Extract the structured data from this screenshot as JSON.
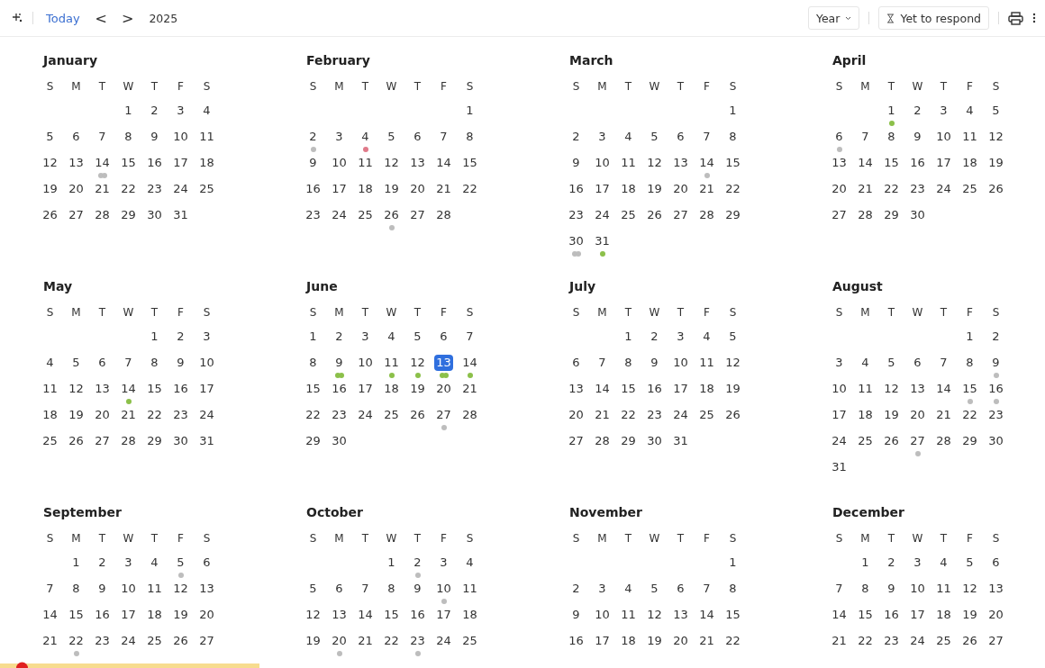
{
  "toolbar": {
    "today": "Today",
    "prev": "<",
    "next": ">",
    "year": "2025",
    "view": "Year",
    "filter": "Yet to respond"
  },
  "months": [
    {
      "name": "January",
      "weekdays": [
        "S",
        "M",
        "T",
        "W",
        "T",
        "F",
        "S"
      ],
      "weeks": [
        [
          "1",
          "2",
          "3",
          "4"
        ],
        [
          "5",
          "6",
          "7",
          "8",
          "9",
          "10",
          "11"
        ],
        [
          "12",
          "13",
          {
            "day": "14",
            "dots": [
              {
                "color": "#bdbdbd"
              },
              {
                "color": "#bdbdbd"
              }
            ]
          },
          "15",
          "16",
          "17",
          "18"
        ],
        [
          "19",
          "20",
          "21",
          "22",
          "23",
          "24",
          "25"
        ],
        [
          "26",
          "27",
          "28",
          "29",
          "30",
          "31"
        ]
      ]
    },
    {
      "name": "February",
      "weekdays": [
        "S",
        "M",
        "T",
        "W",
        "T",
        "F",
        "S"
      ],
      "weeks": [
        [
          "1"
        ],
        [
          {
            "day": "2",
            "dots": [
              {
                "color": "#bdbdbd"
              }
            ]
          },
          "3",
          {
            "day": "4",
            "dots": [
              {
                "color": "#e07a8a"
              }
            ]
          },
          "5",
          "6",
          "7",
          "8"
        ],
        [
          "9",
          "10",
          "11",
          "12",
          "13",
          "14",
          "15"
        ],
        [
          "16",
          "17",
          "18",
          "19",
          "20",
          "21",
          "22"
        ],
        [
          "23",
          "24",
          "25",
          {
            "day": "26",
            "dots": [
              {
                "color": "#bdbdbd"
              }
            ]
          },
          "27",
          "28"
        ]
      ]
    },
    {
      "name": "March",
      "weekdays": [
        "S",
        "M",
        "T",
        "W",
        "T",
        "F",
        "S"
      ],
      "weeks": [
        [
          "1"
        ],
        [
          "2",
          "3",
          "4",
          "5",
          "6",
          "7",
          "8"
        ],
        [
          "9",
          "10",
          "11",
          "12",
          "13",
          {
            "day": "14",
            "dots": [
              {
                "color": "#bdbdbd"
              }
            ]
          },
          "15"
        ],
        [
          "16",
          "17",
          "18",
          "19",
          "20",
          "21",
          "22"
        ],
        [
          "23",
          "24",
          "25",
          "26",
          "27",
          "28",
          "29"
        ],
        [
          {
            "day": "30",
            "dots": [
              {
                "color": "#bdbdbd"
              },
              {
                "color": "#bdbdbd"
              }
            ]
          },
          {
            "day": "31",
            "dots": [
              {
                "color": "#8cc04a"
              }
            ]
          }
        ]
      ]
    },
    {
      "name": "April",
      "weekdays": [
        "S",
        "M",
        "T",
        "W",
        "T",
        "F",
        "S"
      ],
      "weeks": [
        [
          {
            "day": "1",
            "dots": [
              {
                "color": "#8cc04a"
              }
            ]
          },
          "2",
          "3",
          "4",
          "5"
        ],
        [
          {
            "day": "6",
            "dots": [
              {
                "color": "#bdbdbd"
              }
            ]
          },
          "7",
          "8",
          "9",
          "10",
          "11",
          "12"
        ],
        [
          "13",
          "14",
          "15",
          "16",
          "17",
          "18",
          "19"
        ],
        [
          "20",
          "21",
          "22",
          "23",
          "24",
          "25",
          "26"
        ],
        [
          "27",
          "28",
          "29",
          "30"
        ]
      ]
    },
    {
      "name": "May",
      "weekdays": [
        "S",
        "M",
        "T",
        "W",
        "T",
        "F",
        "S"
      ],
      "weeks": [
        [
          "1",
          "2",
          "3"
        ],
        [
          "4",
          "5",
          "6",
          "7",
          "8",
          "9",
          "10"
        ],
        [
          "11",
          "12",
          "13",
          {
            "day": "14",
            "dots": [
              {
                "color": "#8cc04a"
              }
            ]
          },
          "15",
          "16",
          "17"
        ],
        [
          "18",
          "19",
          "20",
          "21",
          "22",
          "23",
          "24"
        ],
        [
          "25",
          "26",
          "27",
          "28",
          "29",
          "30",
          "31"
        ]
      ]
    },
    {
      "name": "June",
      "weekdays": [
        "S",
        "M",
        "T",
        "W",
        "T",
        "F",
        "S"
      ],
      "weeks": [
        [
          "1",
          "2",
          "3",
          "4",
          "5",
          "6",
          "7"
        ],
        [
          "8",
          {
            "day": "9",
            "dots": [
              {
                "color": "#8cc04a"
              },
              {
                "color": "#8cc04a"
              }
            ]
          },
          "10",
          {
            "day": "11",
            "dots": [
              {
                "color": "#8cc04a"
              }
            ]
          },
          {
            "day": "12",
            "dots": [
              {
                "color": "#8cc04a"
              }
            ]
          },
          {
            "day": "13",
            "selected": true,
            "dots": [
              {
                "color": "#8cc04a"
              },
              {
                "color": "#8cc04a"
              }
            ]
          },
          {
            "day": "14",
            "dots": [
              {
                "color": "#8cc04a"
              }
            ]
          }
        ],
        [
          "15",
          "16",
          "17",
          "18",
          "19",
          "20",
          "21"
        ],
        [
          "22",
          "23",
          "24",
          "25",
          "26",
          {
            "day": "27",
            "dots": [
              {
                "color": "#bdbdbd"
              }
            ]
          },
          "28"
        ],
        [
          "29",
          "30"
        ]
      ]
    },
    {
      "name": "July",
      "weekdays": [
        "S",
        "M",
        "T",
        "W",
        "T",
        "F",
        "S"
      ],
      "weeks": [
        [
          "1",
          "2",
          "3",
          "4",
          "5"
        ],
        [
          "6",
          "7",
          "8",
          "9",
          "10",
          "11",
          "12"
        ],
        [
          "13",
          "14",
          "15",
          "16",
          "17",
          "18",
          "19"
        ],
        [
          "20",
          "21",
          "22",
          "23",
          "24",
          "25",
          "26"
        ],
        [
          "27",
          "28",
          "29",
          "30",
          "31"
        ]
      ]
    },
    {
      "name": "August",
      "weekdays": [
        "S",
        "M",
        "T",
        "W",
        "T",
        "F",
        "S"
      ],
      "weeks": [
        [
          "1",
          "2"
        ],
        [
          "3",
          "4",
          "5",
          "6",
          "7",
          "8",
          {
            "day": "9",
            "dots": [
              {
                "color": "#bdbdbd"
              }
            ]
          }
        ],
        [
          "10",
          "11",
          "12",
          "13",
          "14",
          {
            "day": "15",
            "dots": [
              {
                "color": "#bdbdbd"
              }
            ]
          },
          {
            "day": "16",
            "dots": [
              {
                "color": "#bdbdbd"
              }
            ]
          }
        ],
        [
          "17",
          "18",
          "19",
          "20",
          "21",
          "22",
          "23"
        ],
        [
          "24",
          "25",
          "26",
          {
            "day": "27",
            "dots": [
              {
                "color": "#bdbdbd"
              }
            ]
          },
          "28",
          "29",
          "30"
        ],
        [
          "31"
        ]
      ]
    },
    {
      "name": "September",
      "weekdays": [
        "S",
        "M",
        "T",
        "W",
        "T",
        "F",
        "S"
      ],
      "weeks": [
        [
          "1",
          "2",
          "3",
          "4",
          {
            "day": "5",
            "dots": [
              {
                "color": "#bdbdbd"
              }
            ]
          },
          "6"
        ],
        [
          "7",
          "8",
          "9",
          "10",
          "11",
          "12",
          "13"
        ],
        [
          "14",
          "15",
          "16",
          "17",
          "18",
          "19",
          "20"
        ],
        [
          "21",
          {
            "day": "22",
            "dots": [
              {
                "color": "#bdbdbd"
              }
            ]
          },
          "23",
          "24",
          "25",
          "26",
          "27"
        ]
      ]
    },
    {
      "name": "October",
      "weekdays": [
        "S",
        "M",
        "T",
        "W",
        "T",
        "F",
        "S"
      ],
      "weeks": [
        [
          "1",
          {
            "day": "2",
            "dots": [
              {
                "color": "#bdbdbd"
              }
            ]
          },
          "3",
          "4"
        ],
        [
          "5",
          "6",
          "7",
          "8",
          "9",
          {
            "day": "10",
            "dots": [
              {
                "color": "#bdbdbd"
              }
            ]
          },
          "11"
        ],
        [
          "12",
          "13",
          "14",
          "15",
          "16",
          "17",
          "18"
        ],
        [
          "19",
          {
            "day": "20",
            "dots": [
              {
                "color": "#bdbdbd"
              }
            ]
          },
          "21",
          "22",
          {
            "day": "23",
            "dots": [
              {
                "color": "#bdbdbd"
              }
            ]
          },
          "24",
          "25"
        ]
      ]
    },
    {
      "name": "November",
      "weekdays": [
        "S",
        "M",
        "T",
        "W",
        "T",
        "F",
        "S"
      ],
      "weeks": [
        [
          "1"
        ],
        [
          "2",
          "3",
          "4",
          "5",
          "6",
          "7",
          "8"
        ],
        [
          "9",
          "10",
          "11",
          "12",
          "13",
          "14",
          "15"
        ],
        [
          "16",
          "17",
          "18",
          "19",
          "20",
          "21",
          "22"
        ]
      ]
    },
    {
      "name": "December",
      "weekdays": [
        "S",
        "M",
        "T",
        "W",
        "T",
        "F",
        "S"
      ],
      "weeks": [
        [
          "1",
          "2",
          "3",
          "4",
          "5",
          "6"
        ],
        [
          "7",
          "8",
          "9",
          "10",
          "11",
          "12",
          "13"
        ],
        [
          "14",
          "15",
          "16",
          "17",
          "18",
          "19",
          "20"
        ],
        [
          "21",
          "22",
          "23",
          "24",
          "25",
          "26",
          "27"
        ]
      ]
    }
  ]
}
